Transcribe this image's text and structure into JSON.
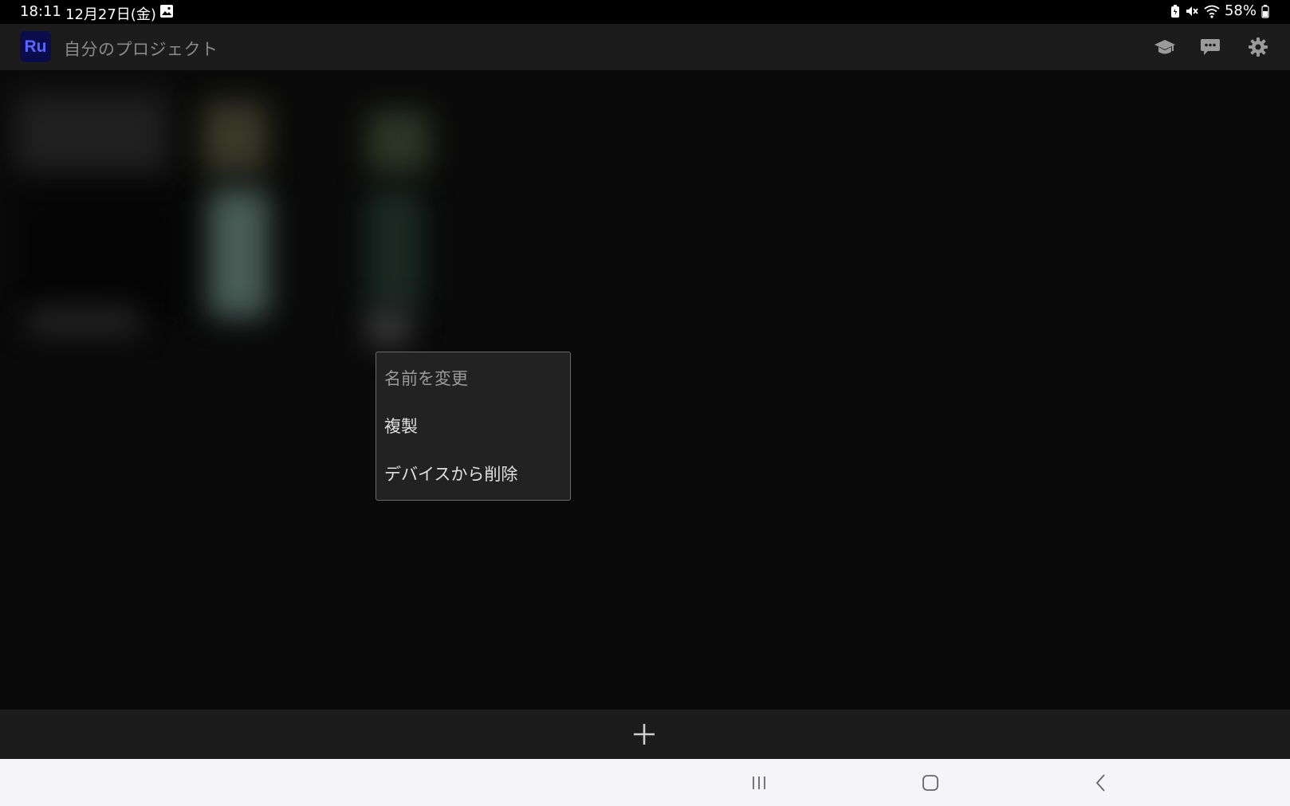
{
  "status_bar": {
    "time": "18:11",
    "date": "12月27日(金)",
    "battery_percent": "58%",
    "icons": [
      "gallery-icon",
      "battery-saver-icon",
      "mute-icon",
      "wifi-icon",
      "battery-icon"
    ]
  },
  "app_bar": {
    "logo_text": "Ru",
    "title": "自分のプロジェクト",
    "actions": [
      "learn-icon",
      "feedback-icon",
      "settings-icon"
    ]
  },
  "context_menu": {
    "items": [
      {
        "label": "名前を変更"
      },
      {
        "label": "複製"
      },
      {
        "label": "デバイスから削除"
      }
    ]
  },
  "bottom_bar": {
    "add_icon": "plus-icon"
  },
  "navigation": {
    "icons": [
      "recents-icon",
      "home-icon",
      "back-icon"
    ]
  },
  "colors": {
    "background": "#0a0a0a",
    "app_bar": "#1c1c1c",
    "logo_bg": "#0b0c4a",
    "logo_text": "#5a66ff",
    "menu_bg": "#222222",
    "nav_bar": "#f5f5f7"
  }
}
